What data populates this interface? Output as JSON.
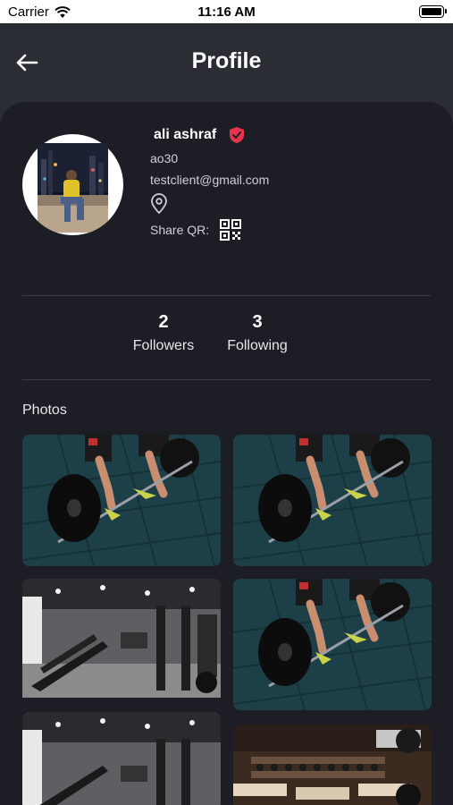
{
  "status_bar": {
    "carrier": "Carrier",
    "time": "11:16 AM"
  },
  "header": {
    "title": "Profile"
  },
  "profile": {
    "name": "ali ashraf",
    "username": "ao30",
    "email": "testclient@gmail.com",
    "share_qr_label": "Share QR:"
  },
  "stats": {
    "followers_count": "2",
    "followers_label": "Followers",
    "following_count": "3",
    "following_label": "Following"
  },
  "photos": {
    "title": "Photos",
    "items": [
      {
        "subject": "barbell-deadlift"
      },
      {
        "subject": "barbell-deadlift"
      },
      {
        "subject": "gym-interior"
      },
      {
        "subject": "barbell-deadlift"
      },
      {
        "subject": "gym-interior"
      },
      {
        "subject": "dumbbell-rack"
      }
    ]
  },
  "icons": {
    "back": "arrow-left-icon",
    "verified": "verified-shield-icon",
    "location": "location-pin-icon",
    "qr": "qr-code-icon"
  },
  "colors": {
    "background": "#2b2d34",
    "card": "#1d1e25",
    "verified_badge": "#e8344a",
    "text_secondary": "#cfd0d5"
  }
}
